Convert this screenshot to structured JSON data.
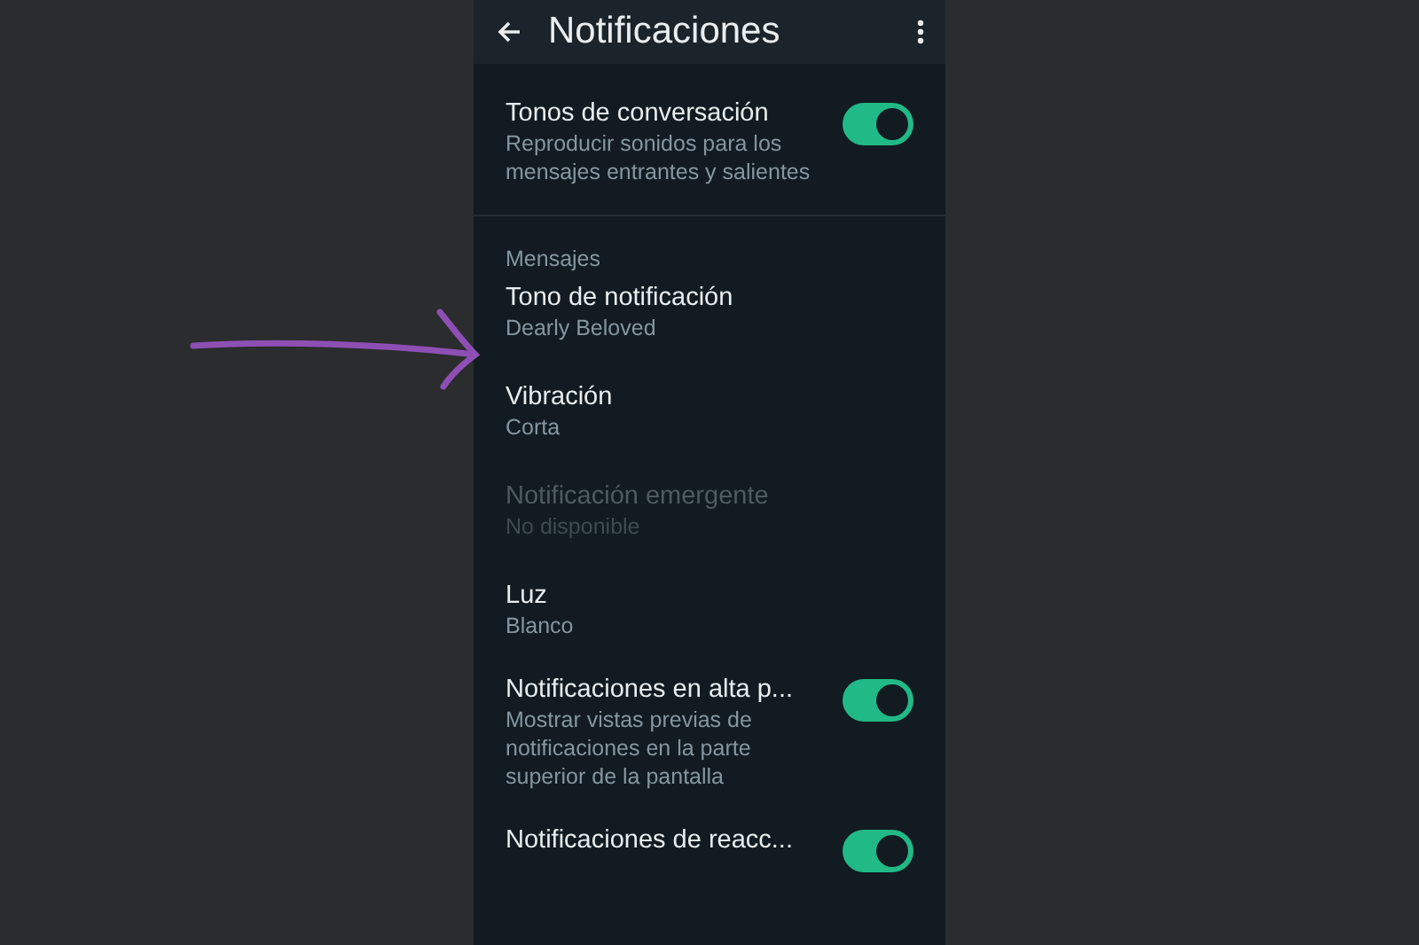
{
  "header": {
    "title": "Notificaciones"
  },
  "top_setting": {
    "title": "Tonos de conversación",
    "subtitle": "Reproducir sonidos para los mensajes entrantes y salientes",
    "on": true
  },
  "section": {
    "heading": "Mensajes",
    "items": [
      {
        "kind": "value",
        "title": "Tono de notificación",
        "subtitle": "Dearly Beloved",
        "disabled": false
      },
      {
        "kind": "value",
        "title": "Vibración",
        "subtitle": "Corta",
        "disabled": false
      },
      {
        "kind": "value",
        "title": "Notificación emergente",
        "subtitle": "No disponible",
        "disabled": true
      },
      {
        "kind": "value",
        "title": "Luz",
        "subtitle": "Blanco",
        "disabled": false
      },
      {
        "kind": "toggle",
        "title": "Notificaciones en alta p...",
        "subtitle": "Mostrar vistas previas de notificaciones en la parte superior de la pantalla",
        "on": true
      },
      {
        "kind": "toggle",
        "title": "Notificaciones de reacc...",
        "on": true
      }
    ]
  }
}
